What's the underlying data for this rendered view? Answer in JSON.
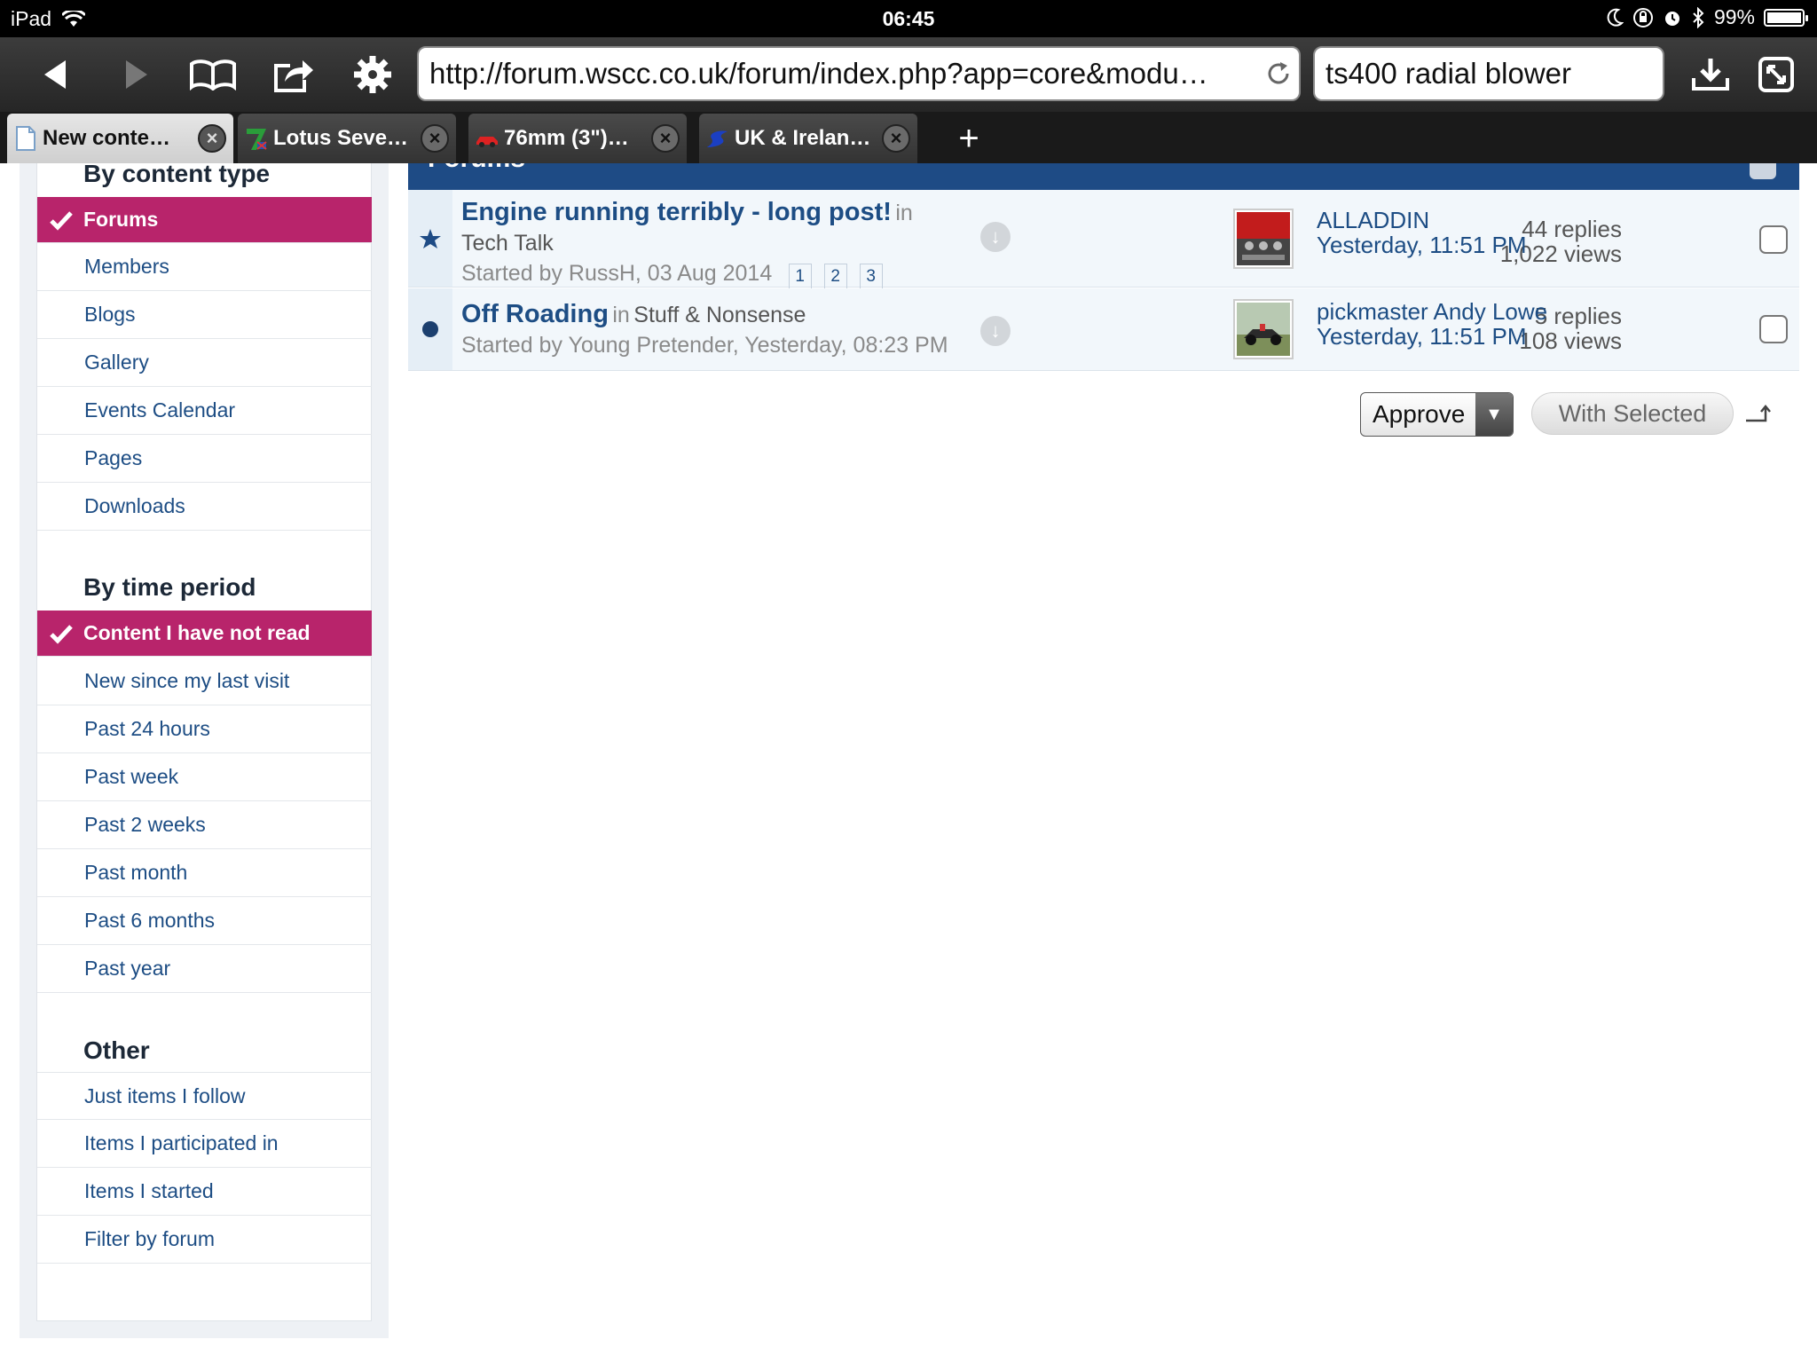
{
  "status_bar": {
    "device": "iPad",
    "time": "06:45",
    "battery": "99%",
    "battery_level": 0.99
  },
  "browser": {
    "url": "http://forum.wscc.co.uk/forum/index.php?app=core&modu…",
    "search_query": "ts400 radial blower",
    "tabs": [
      {
        "title": "New conte…",
        "active": true,
        "favicon": "document-icon"
      },
      {
        "title": "Lotus Seve…",
        "active": false,
        "favicon": "seven-logo-icon"
      },
      {
        "title": "76mm (3\")…",
        "active": false,
        "favicon": "red-car-icon"
      },
      {
        "title": "UK & Irelan…",
        "active": false,
        "favicon": "blue-s-logo-icon"
      }
    ],
    "new_tab_label": "+"
  },
  "sidebar": {
    "content_type": {
      "heading": "By content type",
      "items": [
        "Forums",
        "Members",
        "Blogs",
        "Gallery",
        "Events Calendar",
        "Pages",
        "Downloads"
      ],
      "selected_index": 0
    },
    "time_period": {
      "heading": "By time period",
      "items": [
        "Content I have not read",
        "New since my last visit",
        "Past 24 hours",
        "Past week",
        "Past 2 weeks",
        "Past month",
        "Past 6 months",
        "Past year"
      ],
      "selected_index": 0
    },
    "other": {
      "heading": "Other",
      "items": [
        "Just items I follow",
        "Items I participated in",
        "Items I started",
        "Filter by forum"
      ]
    }
  },
  "main": {
    "section_title": "Forums",
    "topics": [
      {
        "title": "Engine running terribly - long post!",
        "in_label": "in",
        "forum": "Tech Talk",
        "started": "Started by RussH, 03 Aug 2014",
        "pages": [
          "1",
          "2",
          "3"
        ],
        "replies": "44 replies",
        "views": "1,022 views",
        "last_poster": "ALLADDIN",
        "last_time": "Yesterday, 11:51 PM",
        "status_icon": "star-icon"
      },
      {
        "title": "Off Roading",
        "in_label": "in",
        "forum": "Stuff & Nonsense",
        "started": "Started by Young Pretender, Yesterday, 08:23 PM",
        "pages": [],
        "replies": "5 replies",
        "views": "108 views",
        "last_poster": "pickmaster Andy Lowe",
        "last_time": "Yesterday, 11:51 PM",
        "status_icon": "unread-dot-icon"
      }
    ],
    "moderation": {
      "action": "Approve",
      "submit": "With Selected"
    }
  },
  "colors": {
    "accent_active": "#b8246b",
    "link": "#1d4d84",
    "header_bar": "#1e4b85"
  }
}
